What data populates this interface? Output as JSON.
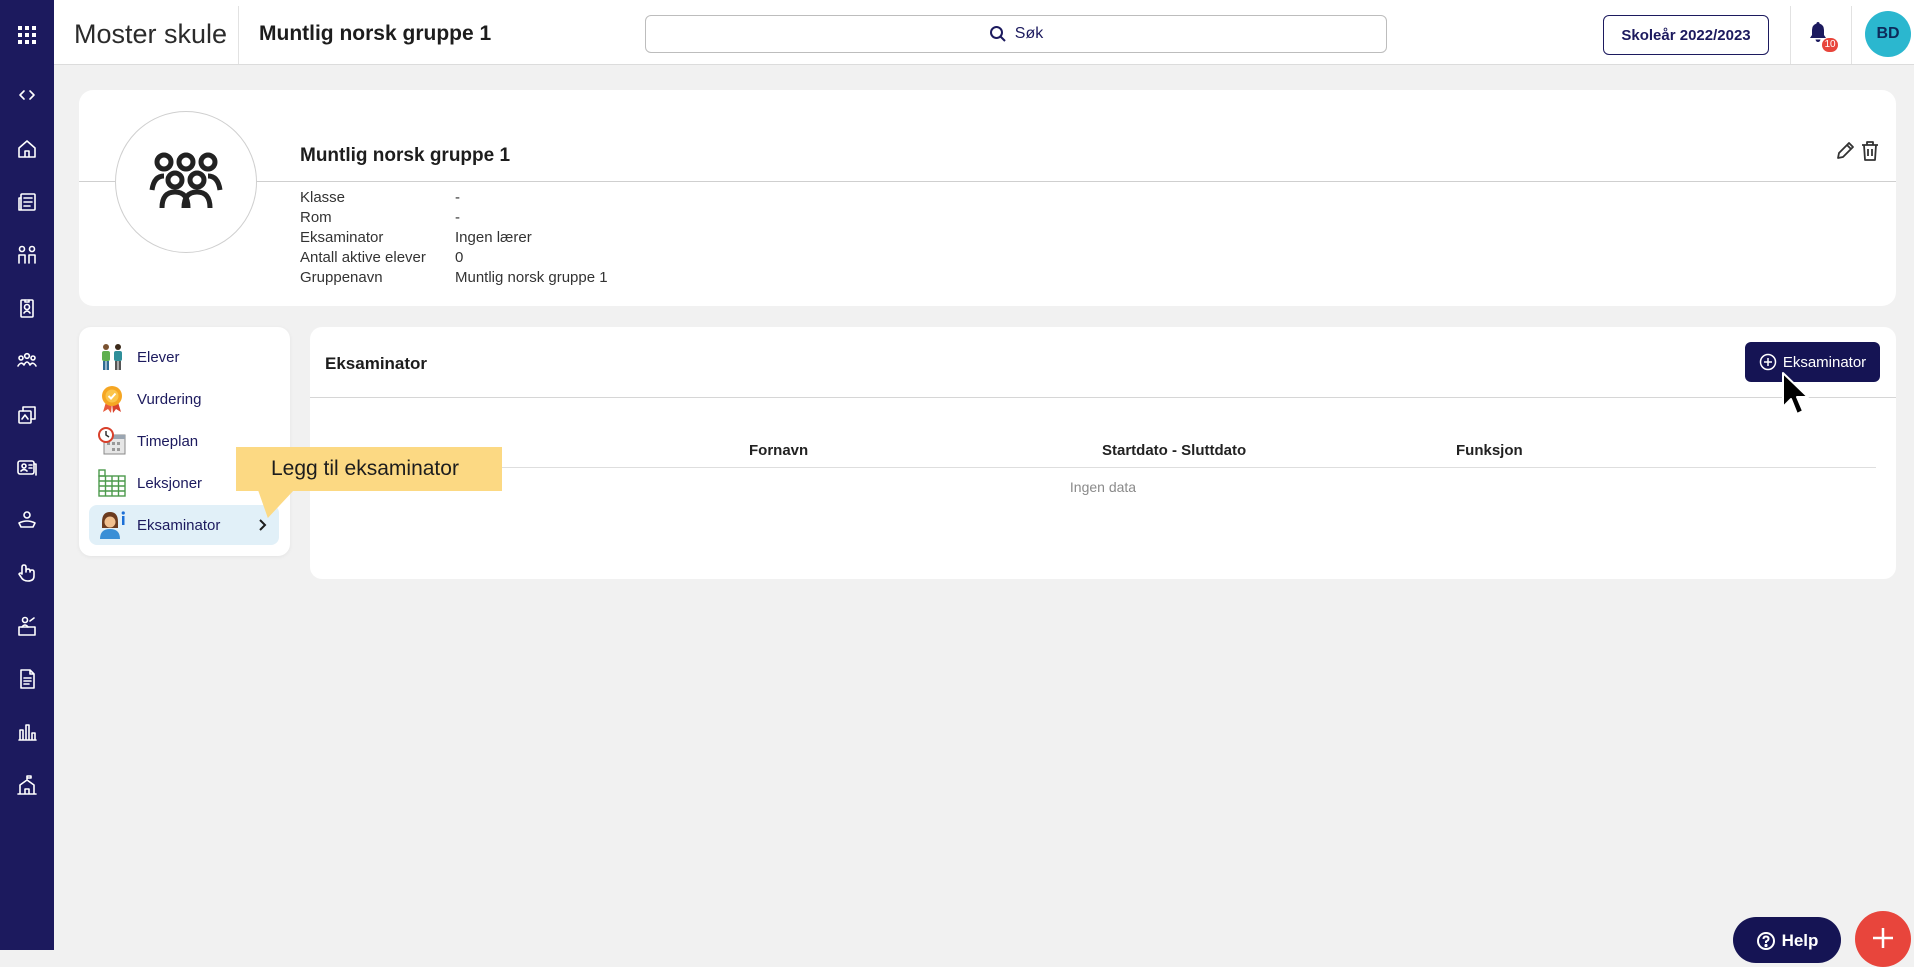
{
  "topbar": {
    "brand": "Moster skule",
    "page_title": "Muntlig norsk gruppe 1",
    "search_label": "Søk",
    "school_year_label": "Skoleår 2022/2023",
    "notification_count": "10",
    "avatar_initials": "BD"
  },
  "rail": {
    "items": [
      "apps-grid-icon",
      "expand-collapse-icon",
      "home-icon",
      "news-icon",
      "groups-icon",
      "badge-icon",
      "people-icon",
      "activity-icon",
      "id-card-icon",
      "reading-icon",
      "hand-icon",
      "teacher-icon",
      "document-icon",
      "bar-chart-icon",
      "school-icon"
    ]
  },
  "group": {
    "title": "Muntlig norsk gruppe 1",
    "fields": [
      {
        "key": "Klasse",
        "value": "-"
      },
      {
        "key": "Rom",
        "value": "-"
      },
      {
        "key": "Eksaminator",
        "value": "Ingen lærer"
      },
      {
        "key": "Antall aktive elever",
        "value": "0"
      },
      {
        "key": "Gruppenavn",
        "value": "Muntlig norsk gruppe 1"
      }
    ]
  },
  "menu": {
    "items": [
      {
        "label": "Elever",
        "icon": "students-icon"
      },
      {
        "label": "Vurdering",
        "icon": "assessment-badge-icon"
      },
      {
        "label": "Timeplan",
        "icon": "schedule-icon"
      },
      {
        "label": "Leksjoner",
        "icon": "lessons-grid-icon"
      },
      {
        "label": "Eksaminator",
        "icon": "examiner-icon"
      }
    ]
  },
  "tooltip": {
    "text": "Legg til eksaminator"
  },
  "main": {
    "title": "Eksaminator",
    "add_button_label": "Eksaminator",
    "columns": [
      "Fornavn",
      "Startdato - Sluttdato",
      "Funksjon"
    ],
    "empty_text": "Ingen data"
  },
  "bottom": {
    "help_label": "Help"
  },
  "colors": {
    "rail": "#1c1a5e",
    "primary_button": "#151454",
    "accent_red": "#e8453c",
    "avatar": "#2bb7cf",
    "tooltip": "#fcd983"
  }
}
